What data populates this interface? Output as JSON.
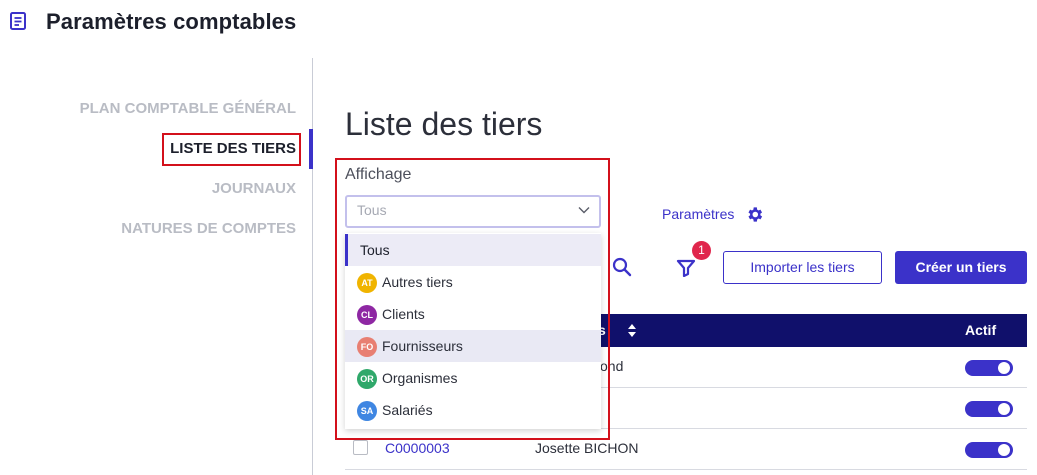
{
  "header": {
    "title": "Paramètres comptables",
    "icon": "document-list-icon"
  },
  "nav": {
    "items": [
      {
        "label": "PLAN COMPTABLE GÉNÉRAL",
        "active": false
      },
      {
        "label": "LISTE DES TIERS",
        "active": true
      },
      {
        "label": "JOURNAUX",
        "active": false
      },
      {
        "label": "NATURES DE COMPTES",
        "active": false
      }
    ]
  },
  "main": {
    "title": "Liste des tiers",
    "affichage": {
      "label": "Affichage",
      "selected_value": "Tous",
      "options": [
        {
          "label": "Tous",
          "badge": "",
          "color": ""
        },
        {
          "label": "Autres tiers",
          "badge": "AT",
          "color": "#f0b400"
        },
        {
          "label": "Clients",
          "badge": "CL",
          "color": "#8e27a3"
        },
        {
          "label": "Fournisseurs",
          "badge": "FO",
          "color": "#e87f72"
        },
        {
          "label": "Organismes",
          "badge": "OR",
          "color": "#2fa86a"
        },
        {
          "label": "Salariés",
          "badge": "SA",
          "color": "#3f86e2"
        }
      ]
    },
    "params_link": "Paramètres",
    "toolbar": {
      "filter_count": "1",
      "import_button": "Importer les tiers",
      "create_button": "Créer un tiers"
    },
    "table": {
      "header_partial": "s",
      "col_actif": "Actif",
      "rows": [
        {
          "code": "",
          "name": "ond",
          "active": true
        },
        {
          "code": "",
          "name": "",
          "active": true
        },
        {
          "code": "C0000003",
          "name": "Josette BICHON",
          "active": true
        }
      ]
    }
  },
  "colors": {
    "accent": "#3b32c9",
    "table_header": "#10106b",
    "highlight_box": "#d3101b",
    "badge": "#e0264c"
  }
}
